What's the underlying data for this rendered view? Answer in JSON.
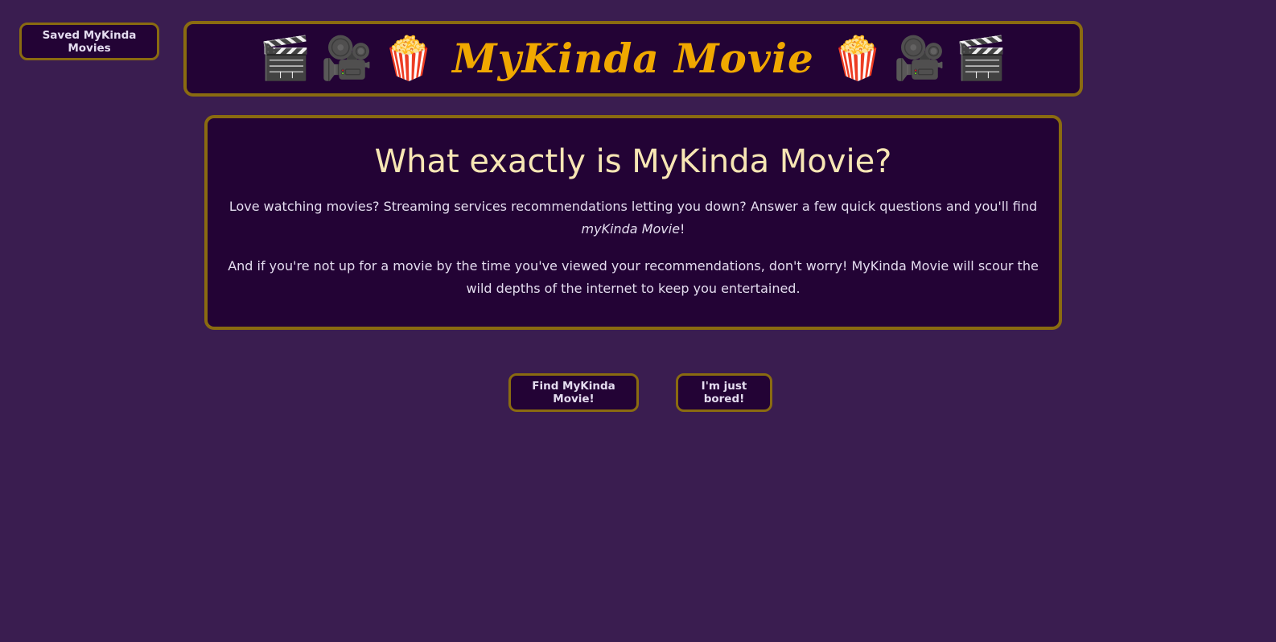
{
  "nav": {
    "saved_label": "Saved MyKinda Movies"
  },
  "header": {
    "title": "MyKinda Movie",
    "emojis": {
      "clapper": "🎬",
      "camera": "🎥",
      "popcorn": "🍿"
    }
  },
  "about": {
    "heading": "What exactly is MyKinda Movie?",
    "p1_text": "Love watching movies? Streaming services recommendations letting you down? Answer a few quick questions and you'll find",
    "p1_emphasis": "myKinda Movie",
    "p1_end": "!",
    "p2": "And if you're not up for a movie by the time you've viewed your recommendations, don't worry! MyKinda Movie will scour the wild depths of the internet to keep you entertained."
  },
  "actions": {
    "find_label": "Find MyKinda Movie!",
    "bored_label": "I'm just bored!"
  },
  "colors": {
    "background": "#3a1d50",
    "panel": "#230335",
    "border": "#8a6b10",
    "title": "#f0a800",
    "heading": "#f7e6b4",
    "text": "#e4dcef"
  }
}
